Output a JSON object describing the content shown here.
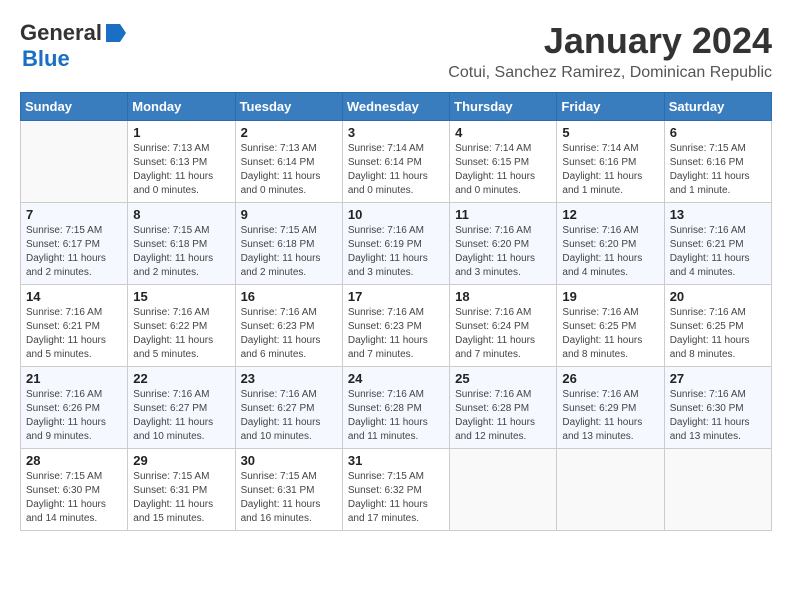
{
  "logo": {
    "line1": "General",
    "line2": "Blue"
  },
  "title": "January 2024",
  "subtitle": "Cotui, Sanchez Ramirez, Dominican Republic",
  "headers": [
    "Sunday",
    "Monday",
    "Tuesday",
    "Wednesday",
    "Thursday",
    "Friday",
    "Saturday"
  ],
  "weeks": [
    [
      {
        "day": "",
        "info": ""
      },
      {
        "day": "1",
        "info": "Sunrise: 7:13 AM\nSunset: 6:13 PM\nDaylight: 11 hours\nand 0 minutes."
      },
      {
        "day": "2",
        "info": "Sunrise: 7:13 AM\nSunset: 6:14 PM\nDaylight: 11 hours\nand 0 minutes."
      },
      {
        "day": "3",
        "info": "Sunrise: 7:14 AM\nSunset: 6:14 PM\nDaylight: 11 hours\nand 0 minutes."
      },
      {
        "day": "4",
        "info": "Sunrise: 7:14 AM\nSunset: 6:15 PM\nDaylight: 11 hours\nand 0 minutes."
      },
      {
        "day": "5",
        "info": "Sunrise: 7:14 AM\nSunset: 6:16 PM\nDaylight: 11 hours\nand 1 minute."
      },
      {
        "day": "6",
        "info": "Sunrise: 7:15 AM\nSunset: 6:16 PM\nDaylight: 11 hours\nand 1 minute."
      }
    ],
    [
      {
        "day": "7",
        "info": "Sunrise: 7:15 AM\nSunset: 6:17 PM\nDaylight: 11 hours\nand 2 minutes."
      },
      {
        "day": "8",
        "info": "Sunrise: 7:15 AM\nSunset: 6:18 PM\nDaylight: 11 hours\nand 2 minutes."
      },
      {
        "day": "9",
        "info": "Sunrise: 7:15 AM\nSunset: 6:18 PM\nDaylight: 11 hours\nand 2 minutes."
      },
      {
        "day": "10",
        "info": "Sunrise: 7:16 AM\nSunset: 6:19 PM\nDaylight: 11 hours\nand 3 minutes."
      },
      {
        "day": "11",
        "info": "Sunrise: 7:16 AM\nSunset: 6:20 PM\nDaylight: 11 hours\nand 3 minutes."
      },
      {
        "day": "12",
        "info": "Sunrise: 7:16 AM\nSunset: 6:20 PM\nDaylight: 11 hours\nand 4 minutes."
      },
      {
        "day": "13",
        "info": "Sunrise: 7:16 AM\nSunset: 6:21 PM\nDaylight: 11 hours\nand 4 minutes."
      }
    ],
    [
      {
        "day": "14",
        "info": "Sunrise: 7:16 AM\nSunset: 6:21 PM\nDaylight: 11 hours\nand 5 minutes."
      },
      {
        "day": "15",
        "info": "Sunrise: 7:16 AM\nSunset: 6:22 PM\nDaylight: 11 hours\nand 5 minutes."
      },
      {
        "day": "16",
        "info": "Sunrise: 7:16 AM\nSunset: 6:23 PM\nDaylight: 11 hours\nand 6 minutes."
      },
      {
        "day": "17",
        "info": "Sunrise: 7:16 AM\nSunset: 6:23 PM\nDaylight: 11 hours\nand 7 minutes."
      },
      {
        "day": "18",
        "info": "Sunrise: 7:16 AM\nSunset: 6:24 PM\nDaylight: 11 hours\nand 7 minutes."
      },
      {
        "day": "19",
        "info": "Sunrise: 7:16 AM\nSunset: 6:25 PM\nDaylight: 11 hours\nand 8 minutes."
      },
      {
        "day": "20",
        "info": "Sunrise: 7:16 AM\nSunset: 6:25 PM\nDaylight: 11 hours\nand 8 minutes."
      }
    ],
    [
      {
        "day": "21",
        "info": "Sunrise: 7:16 AM\nSunset: 6:26 PM\nDaylight: 11 hours\nand 9 minutes."
      },
      {
        "day": "22",
        "info": "Sunrise: 7:16 AM\nSunset: 6:27 PM\nDaylight: 11 hours\nand 10 minutes."
      },
      {
        "day": "23",
        "info": "Sunrise: 7:16 AM\nSunset: 6:27 PM\nDaylight: 11 hours\nand 10 minutes."
      },
      {
        "day": "24",
        "info": "Sunrise: 7:16 AM\nSunset: 6:28 PM\nDaylight: 11 hours\nand 11 minutes."
      },
      {
        "day": "25",
        "info": "Sunrise: 7:16 AM\nSunset: 6:28 PM\nDaylight: 11 hours\nand 12 minutes."
      },
      {
        "day": "26",
        "info": "Sunrise: 7:16 AM\nSunset: 6:29 PM\nDaylight: 11 hours\nand 13 minutes."
      },
      {
        "day": "27",
        "info": "Sunrise: 7:16 AM\nSunset: 6:30 PM\nDaylight: 11 hours\nand 13 minutes."
      }
    ],
    [
      {
        "day": "28",
        "info": "Sunrise: 7:15 AM\nSunset: 6:30 PM\nDaylight: 11 hours\nand 14 minutes."
      },
      {
        "day": "29",
        "info": "Sunrise: 7:15 AM\nSunset: 6:31 PM\nDaylight: 11 hours\nand 15 minutes."
      },
      {
        "day": "30",
        "info": "Sunrise: 7:15 AM\nSunset: 6:31 PM\nDaylight: 11 hours\nand 16 minutes."
      },
      {
        "day": "31",
        "info": "Sunrise: 7:15 AM\nSunset: 6:32 PM\nDaylight: 11 hours\nand 17 minutes."
      },
      {
        "day": "",
        "info": ""
      },
      {
        "day": "",
        "info": ""
      },
      {
        "day": "",
        "info": ""
      }
    ]
  ]
}
